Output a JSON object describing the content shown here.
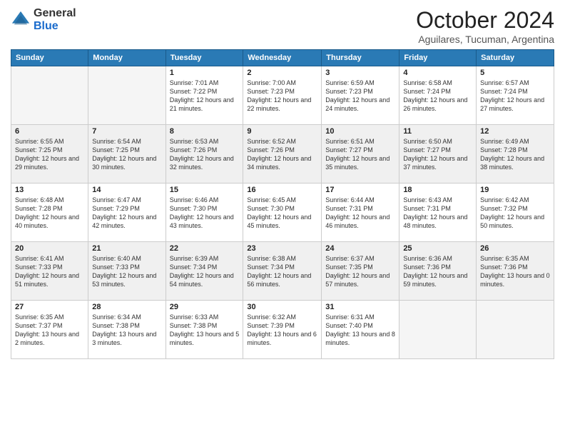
{
  "header": {
    "logo_general": "General",
    "logo_blue": "Blue",
    "month": "October 2024",
    "location": "Aguilares, Tucuman, Argentina"
  },
  "weekdays": [
    "Sunday",
    "Monday",
    "Tuesday",
    "Wednesday",
    "Thursday",
    "Friday",
    "Saturday"
  ],
  "weeks": [
    [
      {
        "day": "",
        "sunrise": "",
        "sunset": "",
        "daylight": ""
      },
      {
        "day": "",
        "sunrise": "",
        "sunset": "",
        "daylight": ""
      },
      {
        "day": "1",
        "sunrise": "Sunrise: 7:01 AM",
        "sunset": "Sunset: 7:22 PM",
        "daylight": "Daylight: 12 hours and 21 minutes."
      },
      {
        "day": "2",
        "sunrise": "Sunrise: 7:00 AM",
        "sunset": "Sunset: 7:23 PM",
        "daylight": "Daylight: 12 hours and 22 minutes."
      },
      {
        "day": "3",
        "sunrise": "Sunrise: 6:59 AM",
        "sunset": "Sunset: 7:23 PM",
        "daylight": "Daylight: 12 hours and 24 minutes."
      },
      {
        "day": "4",
        "sunrise": "Sunrise: 6:58 AM",
        "sunset": "Sunset: 7:24 PM",
        "daylight": "Daylight: 12 hours and 26 minutes."
      },
      {
        "day": "5",
        "sunrise": "Sunrise: 6:57 AM",
        "sunset": "Sunset: 7:24 PM",
        "daylight": "Daylight: 12 hours and 27 minutes."
      }
    ],
    [
      {
        "day": "6",
        "sunrise": "Sunrise: 6:55 AM",
        "sunset": "Sunset: 7:25 PM",
        "daylight": "Daylight: 12 hours and 29 minutes."
      },
      {
        "day": "7",
        "sunrise": "Sunrise: 6:54 AM",
        "sunset": "Sunset: 7:25 PM",
        "daylight": "Daylight: 12 hours and 30 minutes."
      },
      {
        "day": "8",
        "sunrise": "Sunrise: 6:53 AM",
        "sunset": "Sunset: 7:26 PM",
        "daylight": "Daylight: 12 hours and 32 minutes."
      },
      {
        "day": "9",
        "sunrise": "Sunrise: 6:52 AM",
        "sunset": "Sunset: 7:26 PM",
        "daylight": "Daylight: 12 hours and 34 minutes."
      },
      {
        "day": "10",
        "sunrise": "Sunrise: 6:51 AM",
        "sunset": "Sunset: 7:27 PM",
        "daylight": "Daylight: 12 hours and 35 minutes."
      },
      {
        "day": "11",
        "sunrise": "Sunrise: 6:50 AM",
        "sunset": "Sunset: 7:27 PM",
        "daylight": "Daylight: 12 hours and 37 minutes."
      },
      {
        "day": "12",
        "sunrise": "Sunrise: 6:49 AM",
        "sunset": "Sunset: 7:28 PM",
        "daylight": "Daylight: 12 hours and 38 minutes."
      }
    ],
    [
      {
        "day": "13",
        "sunrise": "Sunrise: 6:48 AM",
        "sunset": "Sunset: 7:28 PM",
        "daylight": "Daylight: 12 hours and 40 minutes."
      },
      {
        "day": "14",
        "sunrise": "Sunrise: 6:47 AM",
        "sunset": "Sunset: 7:29 PM",
        "daylight": "Daylight: 12 hours and 42 minutes."
      },
      {
        "day": "15",
        "sunrise": "Sunrise: 6:46 AM",
        "sunset": "Sunset: 7:30 PM",
        "daylight": "Daylight: 12 hours and 43 minutes."
      },
      {
        "day": "16",
        "sunrise": "Sunrise: 6:45 AM",
        "sunset": "Sunset: 7:30 PM",
        "daylight": "Daylight: 12 hours and 45 minutes."
      },
      {
        "day": "17",
        "sunrise": "Sunrise: 6:44 AM",
        "sunset": "Sunset: 7:31 PM",
        "daylight": "Daylight: 12 hours and 46 minutes."
      },
      {
        "day": "18",
        "sunrise": "Sunrise: 6:43 AM",
        "sunset": "Sunset: 7:31 PM",
        "daylight": "Daylight: 12 hours and 48 minutes."
      },
      {
        "day": "19",
        "sunrise": "Sunrise: 6:42 AM",
        "sunset": "Sunset: 7:32 PM",
        "daylight": "Daylight: 12 hours and 50 minutes."
      }
    ],
    [
      {
        "day": "20",
        "sunrise": "Sunrise: 6:41 AM",
        "sunset": "Sunset: 7:33 PM",
        "daylight": "Daylight: 12 hours and 51 minutes."
      },
      {
        "day": "21",
        "sunrise": "Sunrise: 6:40 AM",
        "sunset": "Sunset: 7:33 PM",
        "daylight": "Daylight: 12 hours and 53 minutes."
      },
      {
        "day": "22",
        "sunrise": "Sunrise: 6:39 AM",
        "sunset": "Sunset: 7:34 PM",
        "daylight": "Daylight: 12 hours and 54 minutes."
      },
      {
        "day": "23",
        "sunrise": "Sunrise: 6:38 AM",
        "sunset": "Sunset: 7:34 PM",
        "daylight": "Daylight: 12 hours and 56 minutes."
      },
      {
        "day": "24",
        "sunrise": "Sunrise: 6:37 AM",
        "sunset": "Sunset: 7:35 PM",
        "daylight": "Daylight: 12 hours and 57 minutes."
      },
      {
        "day": "25",
        "sunrise": "Sunrise: 6:36 AM",
        "sunset": "Sunset: 7:36 PM",
        "daylight": "Daylight: 12 hours and 59 minutes."
      },
      {
        "day": "26",
        "sunrise": "Sunrise: 6:35 AM",
        "sunset": "Sunset: 7:36 PM",
        "daylight": "Daylight: 13 hours and 0 minutes."
      }
    ],
    [
      {
        "day": "27",
        "sunrise": "Sunrise: 6:35 AM",
        "sunset": "Sunset: 7:37 PM",
        "daylight": "Daylight: 13 hours and 2 minutes."
      },
      {
        "day": "28",
        "sunrise": "Sunrise: 6:34 AM",
        "sunset": "Sunset: 7:38 PM",
        "daylight": "Daylight: 13 hours and 3 minutes."
      },
      {
        "day": "29",
        "sunrise": "Sunrise: 6:33 AM",
        "sunset": "Sunset: 7:38 PM",
        "daylight": "Daylight: 13 hours and 5 minutes."
      },
      {
        "day": "30",
        "sunrise": "Sunrise: 6:32 AM",
        "sunset": "Sunset: 7:39 PM",
        "daylight": "Daylight: 13 hours and 6 minutes."
      },
      {
        "day": "31",
        "sunrise": "Sunrise: 6:31 AM",
        "sunset": "Sunset: 7:40 PM",
        "daylight": "Daylight: 13 hours and 8 minutes."
      },
      {
        "day": "",
        "sunrise": "",
        "sunset": "",
        "daylight": ""
      },
      {
        "day": "",
        "sunrise": "",
        "sunset": "",
        "daylight": ""
      }
    ]
  ]
}
